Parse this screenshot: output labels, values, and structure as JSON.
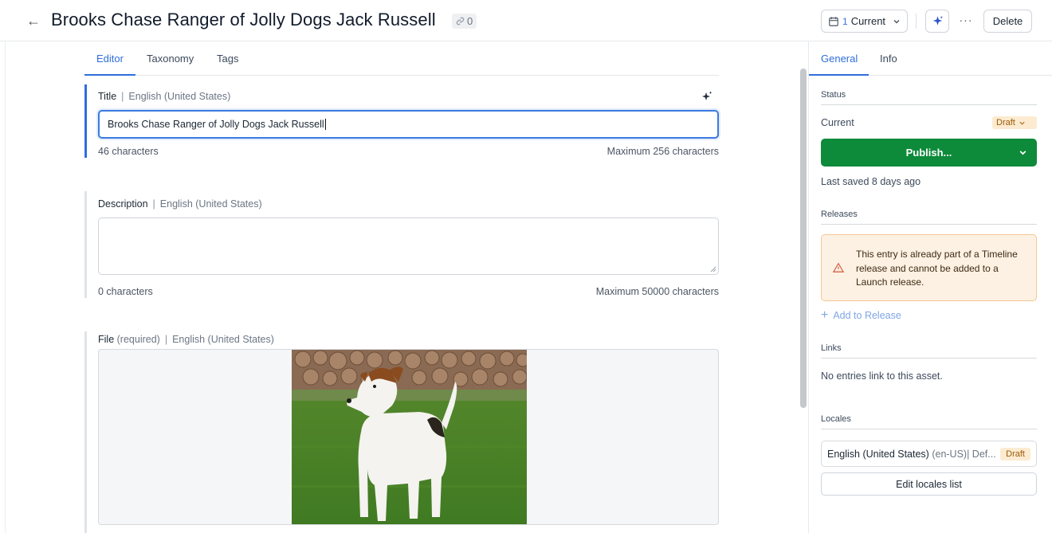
{
  "header": {
    "title": "Brooks Chase Ranger of Jolly Dogs Jack Russell",
    "link_count": "0",
    "version_count": "1",
    "version_label": "Current",
    "more_label": "···",
    "delete_label": "Delete"
  },
  "editor": {
    "tabs": [
      "Editor",
      "Taxonomy",
      "Tags"
    ],
    "active_tab": "Editor",
    "title_field": {
      "label": "Title",
      "locale": "English (United States)",
      "value": "Brooks Chase Ranger of Jolly Dogs Jack Russell",
      "count": "46 characters",
      "max": "Maximum 256 characters"
    },
    "description_field": {
      "label": "Description",
      "locale": "English (United States)",
      "value": "",
      "count": "0 characters",
      "max": "Maximum 50000 characters"
    },
    "file_field": {
      "label": "File",
      "required": "(required)",
      "locale": "English (United States)"
    }
  },
  "sidebar": {
    "tabs": [
      "General",
      "Info"
    ],
    "active_tab": "General",
    "status": {
      "heading": "Status",
      "current_label": "Current",
      "badge": "Draft",
      "publish_label": "Publish...",
      "last_saved": "Last saved 8 days ago"
    },
    "releases": {
      "heading": "Releases",
      "warning": "This entry is already part of a Timeline release and cannot be added to a Launch release.",
      "add_label": "Add to Release"
    },
    "links": {
      "heading": "Links",
      "text": "No entries link to this asset."
    },
    "locales": {
      "heading": "Locales",
      "locale_name": "English (United States)",
      "locale_code": "(en-US)| Def...",
      "locale_badge": "Draft",
      "edit_label": "Edit locales list"
    }
  },
  "colors": {
    "accent": "#2f6fdb",
    "publish": "#0d8a3a",
    "draft_bg": "#fcebd1",
    "warning_bg": "#fdf1e3"
  },
  "icons": [
    "back-arrow-icon",
    "link-icon",
    "calendar-icon",
    "chevron-down-icon",
    "sparkle-icon",
    "warning-triangle-icon",
    "plus-icon"
  ]
}
